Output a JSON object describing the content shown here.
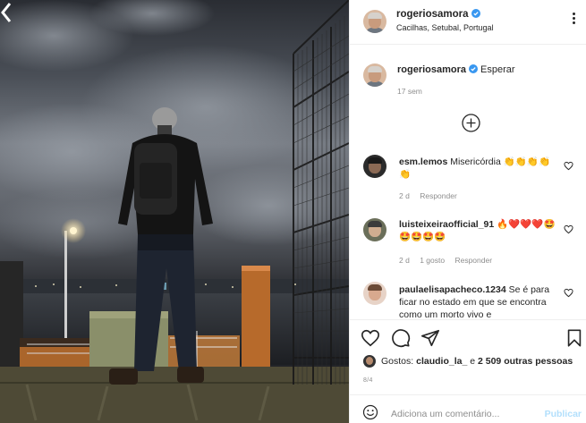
{
  "post": {
    "username": "rogeriosamora",
    "location": "Cacilhas, Setubal, Portugal",
    "caption_user": "rogeriosamora",
    "caption_text": "Esperar",
    "caption_time": "17 sem"
  },
  "comments": [
    {
      "user": "esm.lemos",
      "text": "Misericórdia 👏👏👏👏👏",
      "time": "2 d",
      "likes": "",
      "reply": "Responder"
    },
    {
      "user": "luisteixeiraofficial_91",
      "text": "🔥❤️❤️❤️🤩🤩🤩🤩🤩",
      "time": "2 d",
      "likes": "1 gosto",
      "reply": "Responder"
    },
    {
      "user": "paulaelisapacheco.1234",
      "text": "Se é para ficar no estado em que se encontra como um morto vivo e",
      "time": "",
      "likes": "",
      "reply": ""
    }
  ],
  "likes": {
    "prefix": "Gostos:",
    "user": "claudio_la_",
    "conj": "e",
    "count": "2 509 outras pessoas"
  },
  "date": "8/4",
  "add_comment": {
    "placeholder": "Adiciona um comentário...",
    "publish": "Publicar"
  },
  "colors": {
    "verified": "#3897f0",
    "publish": "#b2dffc",
    "meta": "#8e8e8e",
    "text": "#262626"
  },
  "icons": [
    "verified-icon",
    "more-options-icon",
    "load-more-icon",
    "heart-icon",
    "comment-icon",
    "share-icon",
    "bookmark-icon",
    "emoji-icon",
    "chevron-left-icon"
  ]
}
